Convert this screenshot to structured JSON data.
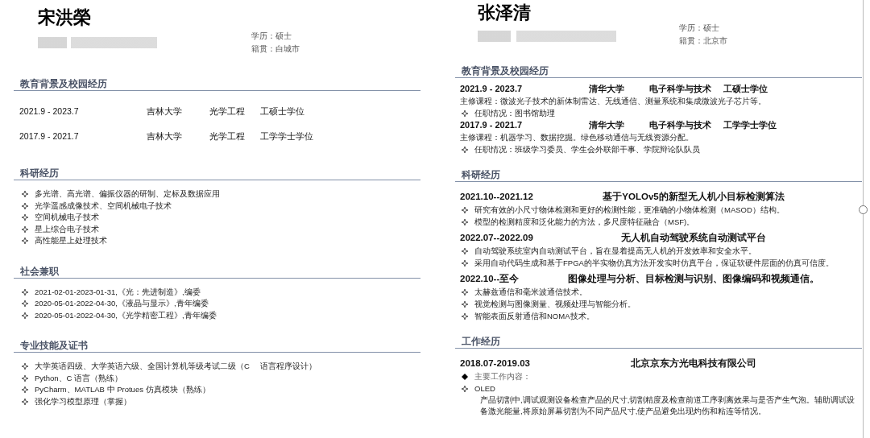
{
  "pages": [
    {
      "name": "宋洪榮",
      "info": [
        "学历：硕士",
        "籍贯：白城市"
      ],
      "sections": [
        {
          "title": "教育背景及校园经历",
          "blocks": [
            {
              "kind": "row",
              "cells": [
                "2021.9 - 2023.7",
                "吉林大学",
                "光学工程",
                "工硕士学位"
              ]
            },
            {
              "kind": "row",
              "cells": [
                "2017.9 - 2021.7",
                "吉林大学",
                "光学工程",
                "工学学士学位"
              ]
            }
          ]
        },
        {
          "title": "科研经历",
          "blocks": [
            {
              "kind": "bullet",
              "text": "多光谱、高光谱、偏振仪器的研制、定标及数据应用"
            },
            {
              "kind": "bullet",
              "text": "光学遥感成像技术、空间机械电子技术"
            },
            {
              "kind": "bullet",
              "text": "空间机械电子技术"
            },
            {
              "kind": "bullet",
              "text": "星上综合电子技术"
            },
            {
              "kind": "bullet",
              "text": "高性能星上处理技术"
            }
          ]
        },
        {
          "title": "社会兼职",
          "blocks": [
            {
              "kind": "bullet",
              "text": "2021-02-01-2023-01-31,《光：先进制造》,编委"
            },
            {
              "kind": "bullet",
              "text": "2020-05-01-2022-04-30,《液晶与显示》,青年编委"
            },
            {
              "kind": "bullet",
              "text": "2020-05-01-2022-04-30,《光学精密工程》,青年编委"
            }
          ]
        },
        {
          "title": "专业技能及证书",
          "blocks": [
            {
              "kind": "bullet",
              "text": "大学英语四级、大学英语六级、全国计算机等级考试二级（C　 语言程序设计）"
            },
            {
              "kind": "bullet",
              "text": "Python、C 语言（熟练）"
            },
            {
              "kind": "bullet",
              "text": "PyCharm、MATLAB 中 Protues 仿真模块（熟练）"
            },
            {
              "kind": "bullet",
              "text": "强化学习模型原理（掌握）"
            }
          ]
        }
      ]
    },
    {
      "name": "张泽清",
      "info": [
        "学历：硕士",
        "籍贯：北京市"
      ],
      "sections": [
        {
          "title": "教育背景及校园经历",
          "blocks": [
            {
              "kind": "heading",
              "cells": [
                "2021.9 - 2023.7",
                "清华大学",
                "电子科学与技术",
                "工硕士学位"
              ]
            },
            {
              "kind": "text",
              "text": "主修课程：微波光子技术的新体制雷达、无线通信、测量系统和集成微波光子芯片等。"
            },
            {
              "kind": "bullet",
              "text": "任职情况：图书馆助理"
            },
            {
              "kind": "heading",
              "cells": [
                "2017.9 - 2021.7",
                "清华大学",
                "电子科学与技术",
                "工学学士学位"
              ]
            },
            {
              "kind": "text",
              "text": "主修课程：机器学习、数据挖掘。绿色移动通信与无线资源分配。"
            },
            {
              "kind": "bullet",
              "text": "任职情况：班级学习委员、学生会外联部干事、学院辩论队队员"
            }
          ]
        },
        {
          "title": "科研经历",
          "blocks": [
            {
              "kind": "title",
              "cells": [
                "2021.10--2021.12",
                "基于YOLOv5的新型无人机小目标检测算法"
              ]
            },
            {
              "kind": "bullet",
              "text": "研究有效的小尺寸物体检测和更好的检测性能，更准确的小物体检测（MASOD）结构。"
            },
            {
              "kind": "bullet",
              "text": "模型的检测精度和泛化能力的方法，多尺度特征融合（MSF)。"
            },
            {
              "kind": "title",
              "cells": [
                "2022.07--2022.09",
                "无人机自动驾驶系统自动测试平台"
              ]
            },
            {
              "kind": "bullet",
              "text": "自动驾驶系统室内自动测试平台，旨在显着提高无人机的开发效率和安全水平。"
            },
            {
              "kind": "bullet",
              "text": "采用自动代码生成和基于FPGA的半实物仿真方法开发实时仿真平台，保证软硬件层面的仿真可信度。"
            },
            {
              "kind": "title",
              "cells": [
                "2022.10--至今",
                "图像处理与分析、目标检测与识别、图像编码和视频通信。"
              ]
            },
            {
              "kind": "bullet",
              "text": "太赫兹通信和毫米波通信技术。"
            },
            {
              "kind": "bullet",
              "text": "视觉检测与图像测量、视频处理与智能分析。"
            },
            {
              "kind": "bullet",
              "text": "智能表面反射通信和NOMA技术。"
            }
          ]
        },
        {
          "title": "工作经历",
          "blocks": [
            {
              "kind": "title",
              "cells": [
                "2018.07-2019.03",
                "北京京东方光电科技有限公司"
              ]
            },
            {
              "kind": "key",
              "text": "主要工作内容："
            },
            {
              "kind": "bullet",
              "text": "OLED"
            },
            {
              "kind": "para",
              "text": "产品切割中,调试观测设备检查产品的尺寸,切割精度及检查前道工序剥离效果与是否产生气泡。辅助调试设备激光能量,将原始屏幕切割为不同产品尺寸,使产品避免出现灼伤和粘连等情况。"
            }
          ]
        }
      ]
    }
  ]
}
